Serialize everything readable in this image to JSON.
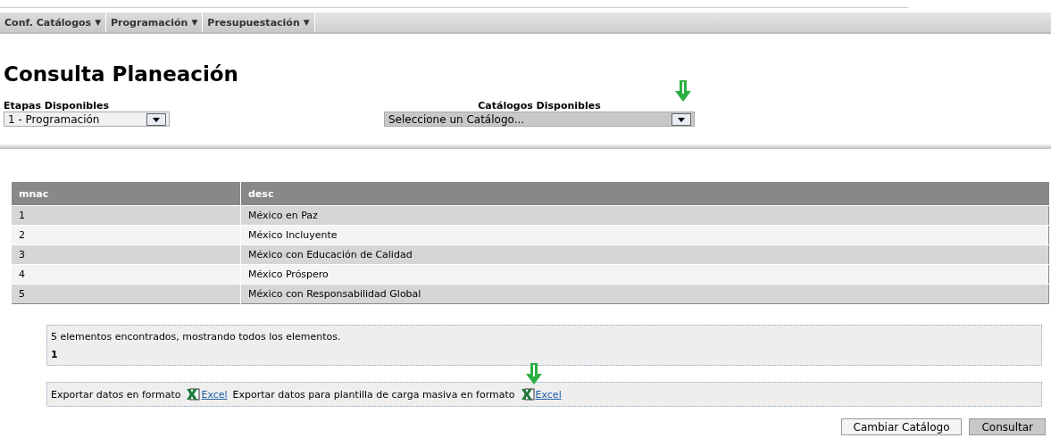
{
  "menu": [
    {
      "label": "Conf. Catálogos",
      "caret": "▼"
    },
    {
      "label": "Programación",
      "caret": "▼"
    },
    {
      "label": "Presupuestación",
      "caret": "▼"
    }
  ],
  "title": "Consulta Planeación",
  "stage_select": {
    "label": "Etapas Disponibles",
    "value": "1 - Programación"
  },
  "catalog_select": {
    "label": "Catálogos Disponibles",
    "value": "Seleccione un Catálogo..."
  },
  "table": {
    "columns": [
      "mnac",
      "desc"
    ],
    "rows": [
      {
        "cells": [
          "1",
          "México en Paz"
        ]
      },
      {
        "cells": [
          "2",
          "México Incluyente"
        ]
      },
      {
        "cells": [
          "3",
          "México con Educación de Calidad"
        ]
      },
      {
        "cells": [
          "4",
          "México Próspero"
        ]
      },
      {
        "cells": [
          "5",
          "México con Responsabilidad Global"
        ]
      }
    ]
  },
  "summary": {
    "text": "5 elementos encontrados, mostrando todos los elementos.",
    "page": "1"
  },
  "export": [
    {
      "text": "Exportar datos en formato",
      "link": "Excel",
      "marked": false
    },
    {
      "text": "Exportar datos para plantilla de carga masiva en formato",
      "link": "Excel",
      "marked": true
    }
  ],
  "buttons": [
    {
      "label": "Cambiar Catálogo",
      "selected": false
    },
    {
      "label": "Consultar",
      "selected": true
    }
  ]
}
